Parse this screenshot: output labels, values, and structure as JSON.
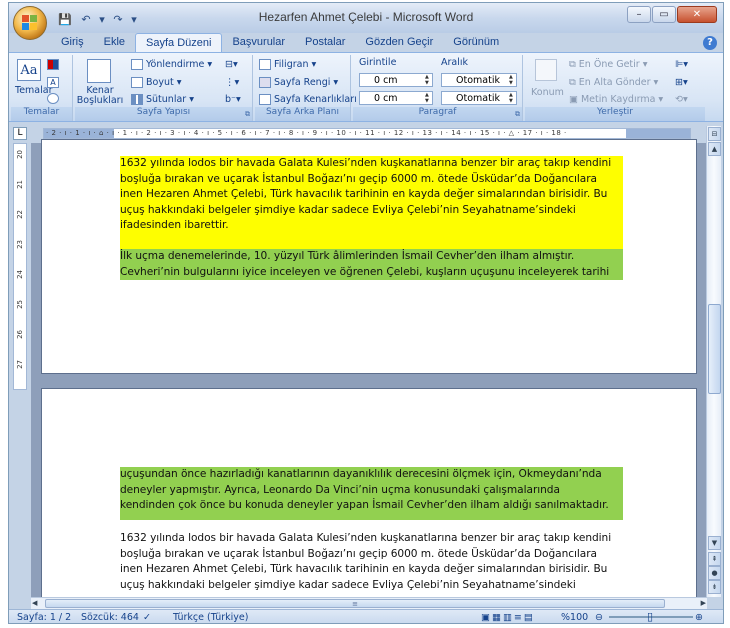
{
  "window": {
    "title": "Hezarfen Ahmet Çelebi - Microsoft Word",
    "controls": [
      "–",
      "▭",
      "✕"
    ]
  },
  "quick_access": [
    "💾",
    "↶",
    "▾",
    "↷",
    "▾"
  ],
  "tabs": [
    "Giriş",
    "Ekle",
    "Sayfa Düzeni",
    "Başvurular",
    "Postalar",
    "Gözden Geçir",
    "Görünüm"
  ],
  "active_tab": "Sayfa Düzeni",
  "ribbon": {
    "temalar": {
      "button": "Temalar",
      "label": "Temalar"
    },
    "sayfa_yapisi": {
      "label": "Sayfa Yapısı",
      "kenar": "Kenar Boşlukları",
      "yonlendirme": "Yönlendirme",
      "boyut": "Boyut",
      "sutunlar": "Sütunlar"
    },
    "sayfa_arka_plani": {
      "label": "Sayfa Arka Planı",
      "filigran": "Filigran",
      "sayfa_rengi": "Sayfa Rengi",
      "kenarliklar": "Sayfa Kenarlıkları"
    },
    "paragraf": {
      "label": "Paragraf",
      "girintile": "Girintile",
      "aralik": "Aralık",
      "left_indent": "0 cm",
      "right_indent": "0 cm",
      "before": "Otomatik",
      "after": "Otomatik"
    },
    "yerlestir": {
      "label": "Yerleştir",
      "konum": "Konum",
      "on": "En Öne Getir",
      "arka": "En Alta Gönder",
      "kaydirma": "Metin Kaydırma"
    }
  },
  "ruler": {
    "horizontal": "· 2 · ı · 1 · ı · ⌂ · ı · 1 · ı · 2 · ı · 3 · ı · 4 · ı · 5 · ı · 6 · ı · 7 · ı · 8 · ı · 9 · ı · 10 · ı · 11 · ı · 12 · ı · 13 · ı · 14 · ı · 15 · ı · △ · 17 · ı · 18 ·",
    "vertical": [
      "20",
      "21",
      "22",
      "23",
      "24",
      "25",
      "26",
      "27"
    ]
  },
  "page1": {
    "yellow": [
      "1632 yılında lodos bir havada Galata Kulesi’nden kuşkanatlarına benzer bir araç takıp kendini",
      "boşluğa bırakan ve uçarak İstanbul Boğazı’nı geçip 6000 m. ötede Üsküdar’da Doğancılara",
      "inen Hezaren Ahmet Çelebi, Türk havacılık tarihinin en kayda değer simalarından birisidir. Bu",
      "uçuş hakkındaki belgeler şimdiye kadar sadece Evliya Çelebi’nin Seyahatname’sindeki",
      "ifadesinden ibarettir."
    ],
    "green": [
      "İlk uçma denemelerinde, 10. yüzyıl Türk âlimlerinden İsmail Cevher’den ilham almıştır.",
      "Cevheri’nin bulgularını iyice inceleyen ve öğrenen Çelebi, kuşların uçuşunu inceleyerek tarihi"
    ]
  },
  "page2": {
    "green": [
      "uçuşundan önce hazırladığı kanatlarının dayanıklılık derecesini ölçmek için, Okmeydanı’nda",
      "deneyler yapmıştır. Ayrıca, Leonardo Da Vinci’nin uçma konusundaki çalışmalarında",
      "kendinden çok önce bu konuda deneyler yapan İsmail Cevher’den ilham aldığı sanılmaktadır."
    ],
    "white": [
      "1632 yılında lodos bir havada Galata Kulesi’nden kuşkanatlarına benzer bir araç takıp kendini",
      "boşluğa bırakan ve uçarak İstanbul Boğazı’nı geçip 6000 m. ötede Üsküdar’da Doğancılara",
      "inen Hezaren Ahmet Çelebi, Türk havacılık tarihinin en kayda değer simalarından birisidir. Bu",
      "uçuş hakkındaki belgeler şimdiye kadar sadece Evliya Çelebi’nin Seyahatname’sindeki"
    ]
  },
  "status": {
    "page": "Sayfa: 1 / 2",
    "words": "Sözcük: 464",
    "language": "Türkçe (Türkiye)",
    "zoom": "%100"
  }
}
